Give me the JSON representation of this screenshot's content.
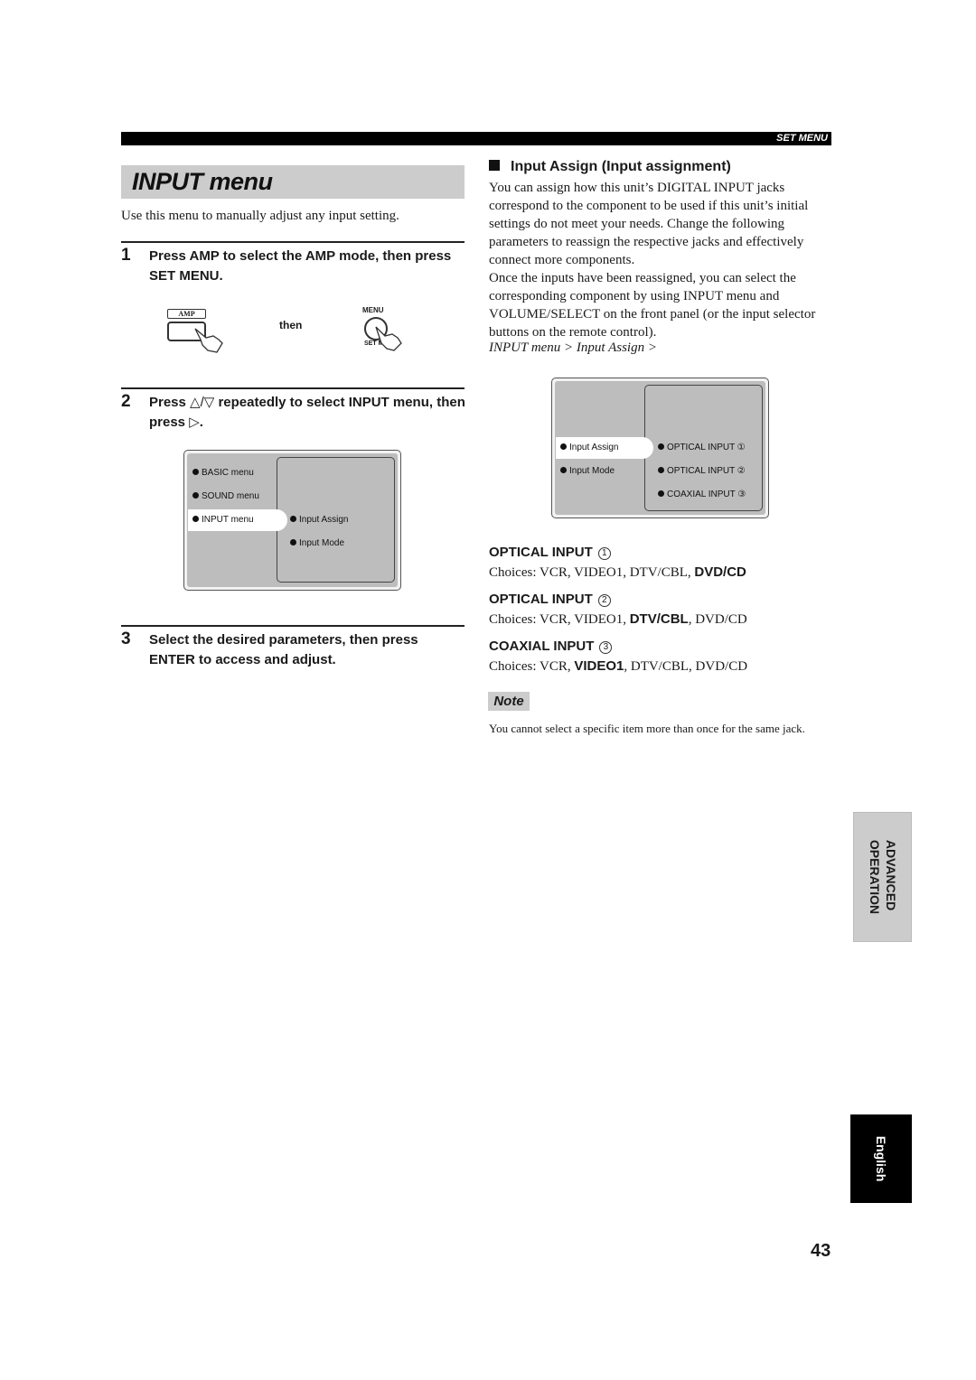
{
  "header": {
    "section_label": "SET MENU"
  },
  "left": {
    "title": "INPUT menu",
    "intro": "Use this menu to manually adjust any input setting.",
    "steps": [
      {
        "num": "1",
        "text": "Press AMP to select the AMP mode, then press SET MENU."
      },
      {
        "num": "2",
        "text_pre": "Press ",
        "up_down_glyph": "△/▽",
        "text_mid": " repeatedly to select INPUT menu, then press ",
        "right_glyph": "▷",
        "text_post": "."
      },
      {
        "num": "3",
        "text": "Select the desired parameters, then press ENTER to access and adjust."
      }
    ],
    "remote": {
      "amp_label": "AMP",
      "then": "then",
      "menu_label": "MENU",
      "setmenu_label": "SET MENU"
    },
    "osd1": {
      "left_items": [
        "BASIC menu",
        "SOUND menu",
        "INPUT menu"
      ],
      "selected_index": 2,
      "right_items": [
        "Input Assign",
        "Input Mode"
      ]
    }
  },
  "right": {
    "section_title": "Input Assign (Input assignment)",
    "para1": "You can assign how this unit’s DIGITAL INPUT jacks correspond to the component to be used if this unit’s initial settings do not meet your needs. Change the following parameters to reassign the respective jacks and effectively connect more components.",
    "para2": "Once the inputs have been reassigned, you can select the corresponding component by using INPUT menu and VOLUME/SELECT on the front panel (or the input selector buttons on the remote control).",
    "breadcrumb": "INPUT menu > Input Assign >",
    "osd2": {
      "left_items": [
        "Input Assign",
        "Input Mode"
      ],
      "selected_index": 0,
      "right_items": [
        "OPTICAL INPUT ①",
        "OPTICAL INPUT ②",
        "COAXIAL INPUT ③"
      ]
    },
    "params": [
      {
        "name": "OPTICAL INPUT",
        "num": "1",
        "choices_label": "Choices:",
        "choices": [
          "VCR",
          "VIDEO1",
          "DTV/CBL",
          "DVD/CD"
        ],
        "default": "DVD/CD"
      },
      {
        "name": "OPTICAL INPUT",
        "num": "2",
        "choices_label": "Choices:",
        "choices": [
          "VCR",
          "VIDEO1",
          "DTV/CBL",
          "DVD/CD"
        ],
        "default": "DTV/CBL"
      },
      {
        "name": "COAXIAL INPUT",
        "num": "3",
        "choices_label": "Choices:",
        "choices": [
          "VCR",
          "VIDEO1",
          "DTV/CBL",
          "DVD/CD"
        ],
        "default": "VIDEO1"
      }
    ],
    "note_label": "Note",
    "note_text": "You cannot select a specific item more than once for the same jack."
  },
  "side_tabs": {
    "chapter_line1": "ADVANCED",
    "chapter_line2": "OPERATION",
    "language": "English"
  },
  "page_number": "43"
}
